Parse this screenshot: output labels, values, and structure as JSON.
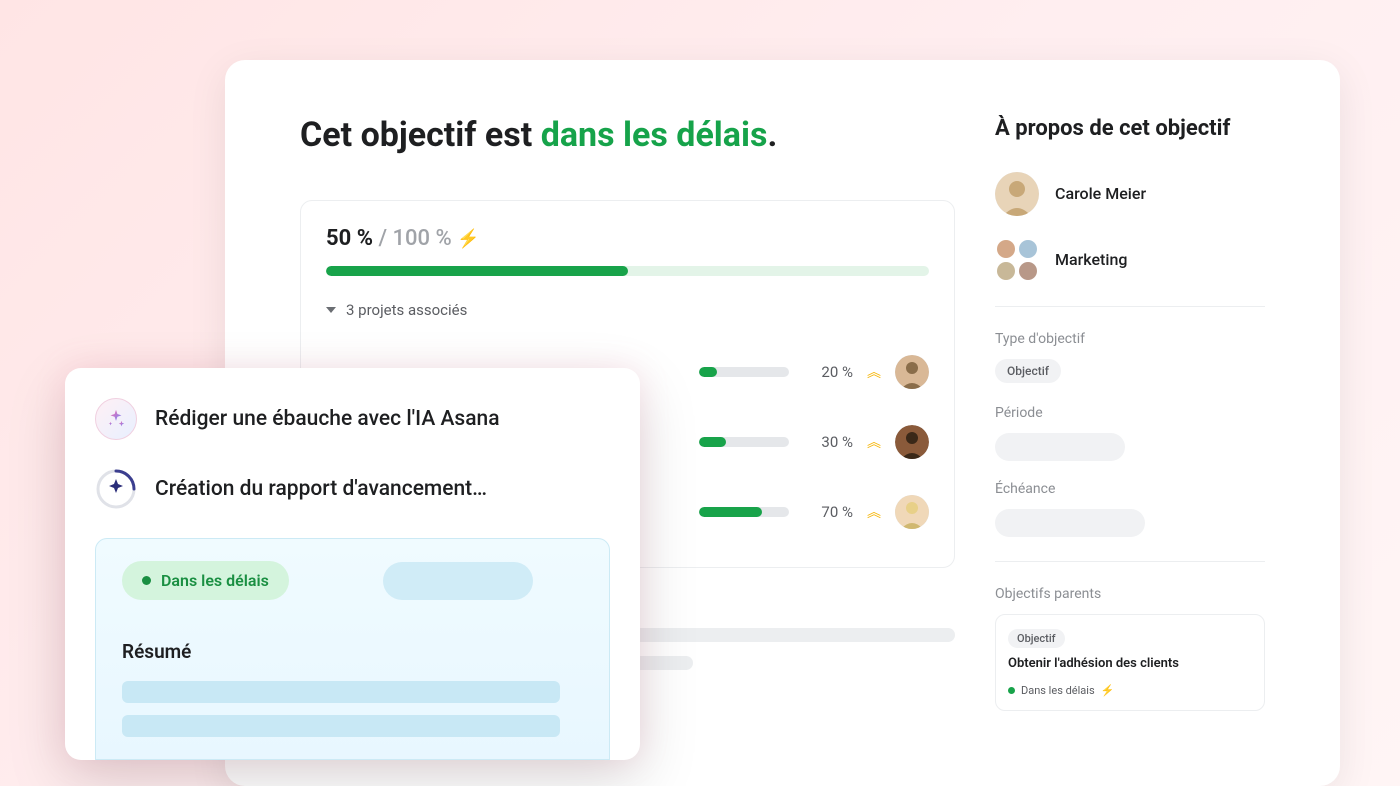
{
  "goal": {
    "prefix": "Cet objectif est ",
    "highlight": "dans les délais",
    "suffix": "."
  },
  "progress": {
    "current": "50 %",
    "separator": " / ",
    "total": "100 %",
    "percent_fill": 50
  },
  "projects": {
    "header": "3 projets associés",
    "rows": [
      {
        "percent": "20 %",
        "fill": 20
      },
      {
        "percent": "30 %",
        "fill": 30
      },
      {
        "percent": "70 %",
        "fill": 70
      }
    ]
  },
  "ai": {
    "draft_label": "Rédiger une ébauche avec l'IA Asana",
    "creating_label": "Création du rapport d'avancement…",
    "status_pill": "Dans les délais",
    "resume_heading": "Résumé"
  },
  "sidebar": {
    "about_heading": "À propos de cet objectif",
    "owner_name": "Carole Meier",
    "team_name": "Marketing",
    "type_label": "Type d'objectif",
    "type_chip": "Objectif",
    "period_label": "Période",
    "due_label": "Échéance",
    "parents_label": "Objectifs parents",
    "parent": {
      "chip": "Objectif",
      "title": "Obtenir l'adhésion des clients",
      "status": "Dans les délais"
    }
  }
}
